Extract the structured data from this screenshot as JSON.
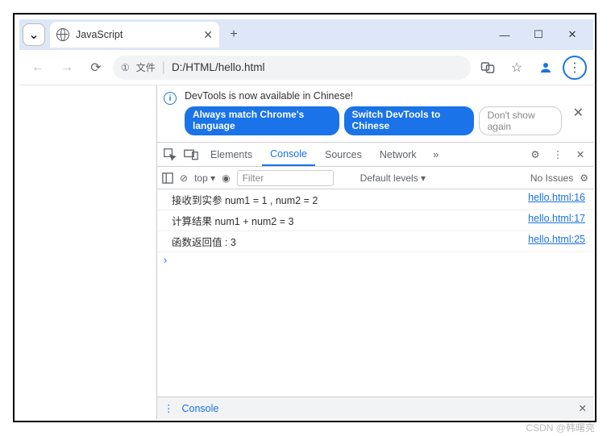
{
  "titlebar": {
    "tab_title": "JavaScript",
    "dropdown_glyph": "⌄",
    "close_tab": "✕",
    "new_tab": "+",
    "minimize": "—",
    "maximize": "☐",
    "close": "✕"
  },
  "addrbar": {
    "back": "←",
    "forward": "→",
    "reload": "⟳",
    "file_chip_prefix": "①",
    "file_chip_label": "文件",
    "url": "D:/HTML/hello.html",
    "translate": "🔠",
    "star": "☆",
    "profile": "👤",
    "menu": "⋮"
  },
  "infobar": {
    "icon_glyph": "i",
    "text": "DevTools is now available in Chinese!",
    "btn_match": "Always match Chrome's language",
    "btn_switch": "Switch DevTools to Chinese",
    "btn_dismiss": "Don't show again",
    "close": "✕"
  },
  "paneltabs": {
    "inspect_icon": "⇱",
    "device_icon": "⧉",
    "items": [
      "Elements",
      "Console",
      "Sources",
      "Network"
    ],
    "active": "Console",
    "more": "»",
    "settings": "⚙",
    "kebab": "⋮",
    "close": "✕"
  },
  "ctoolbar": {
    "sidebar_icon": "▯",
    "clear_icon": "⊘",
    "context": "top ▾",
    "eye": "◉",
    "filter_placeholder": "Filter",
    "levels": "Default levels ▾",
    "issues": "No Issues",
    "gear": "⚙"
  },
  "logs": [
    {
      "msg": "接收到实参 num1 = 1 , num2 = 2",
      "link": "hello.html:16"
    },
    {
      "msg": "计算结果 num1 + num2 = 3",
      "link": "hello.html:17"
    },
    {
      "msg": "函数返回值 : 3",
      "link": "hello.html:25"
    }
  ],
  "prompt": "›",
  "drawer": {
    "kebab": "⋮",
    "label": "Console",
    "close": "✕"
  },
  "watermark": "CSDN @韩曙亮"
}
